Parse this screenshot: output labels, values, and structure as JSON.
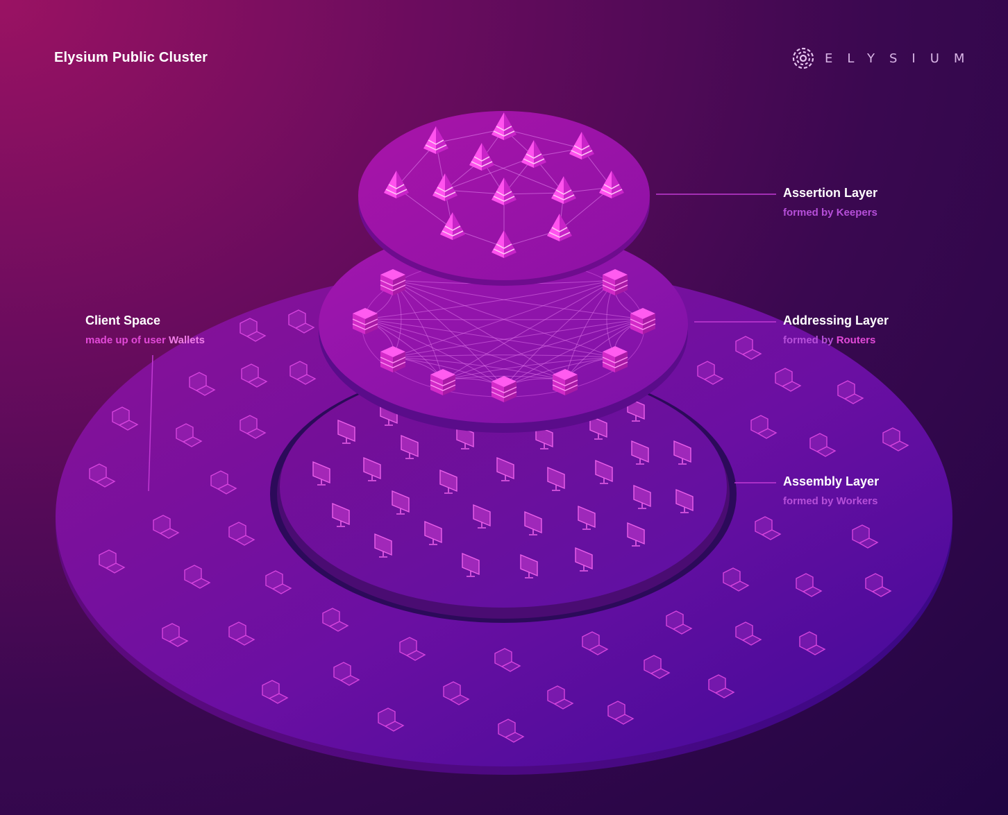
{
  "header": {
    "title": "Elysium Public Cluster",
    "logo_text": "ELYSIUM",
    "logo_icon": "elysium-swirl-icon"
  },
  "labels": {
    "assertion": {
      "title": "Assertion Layer",
      "prefix": "formed by",
      "highlight": "Keepers"
    },
    "addressing": {
      "title": "Addressing Layer",
      "prefix": "formed by",
      "highlight": "Routers"
    },
    "assembly": {
      "title": "Assembly Layer",
      "prefix": "formed by",
      "highlight": "Workers"
    },
    "client": {
      "title": "Client Space",
      "prefix": "made up of user",
      "highlight": "Wallets"
    }
  },
  "icons": {
    "keeper": "pyramid-icon",
    "router": "stacked-cube-icon",
    "worker": "monitor-icon",
    "wallet": "laptop-icon"
  },
  "colors": {
    "background_top": "#9a1263",
    "background_bottom": "#200542",
    "node_magenta": "#ee35d8",
    "label_secondary": "#b64fd9",
    "label_highlight": "#e24ad8",
    "leader_line": "#c23ad4"
  }
}
